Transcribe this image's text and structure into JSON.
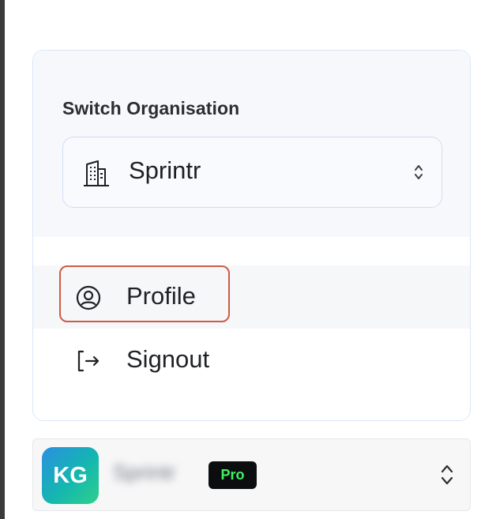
{
  "switcher": {
    "label": "Switch Organisation",
    "selected_org": "Sprintr"
  },
  "menu": {
    "items": [
      {
        "label": "Profile",
        "icon": "user-circle-icon"
      },
      {
        "label": "Signout",
        "icon": "sign-out-icon"
      }
    ]
  },
  "footer": {
    "avatar_initials": "KG",
    "org_name": "Sprintr",
    "plan_badge": "Pro"
  },
  "colors": {
    "highlight_border": "#cf5b47",
    "badge_bg": "#0c0d0f",
    "badge_text": "#3ff065",
    "avatar_gradient_start": "#2a8fe0",
    "avatar_gradient_end": "#2fd08a"
  }
}
